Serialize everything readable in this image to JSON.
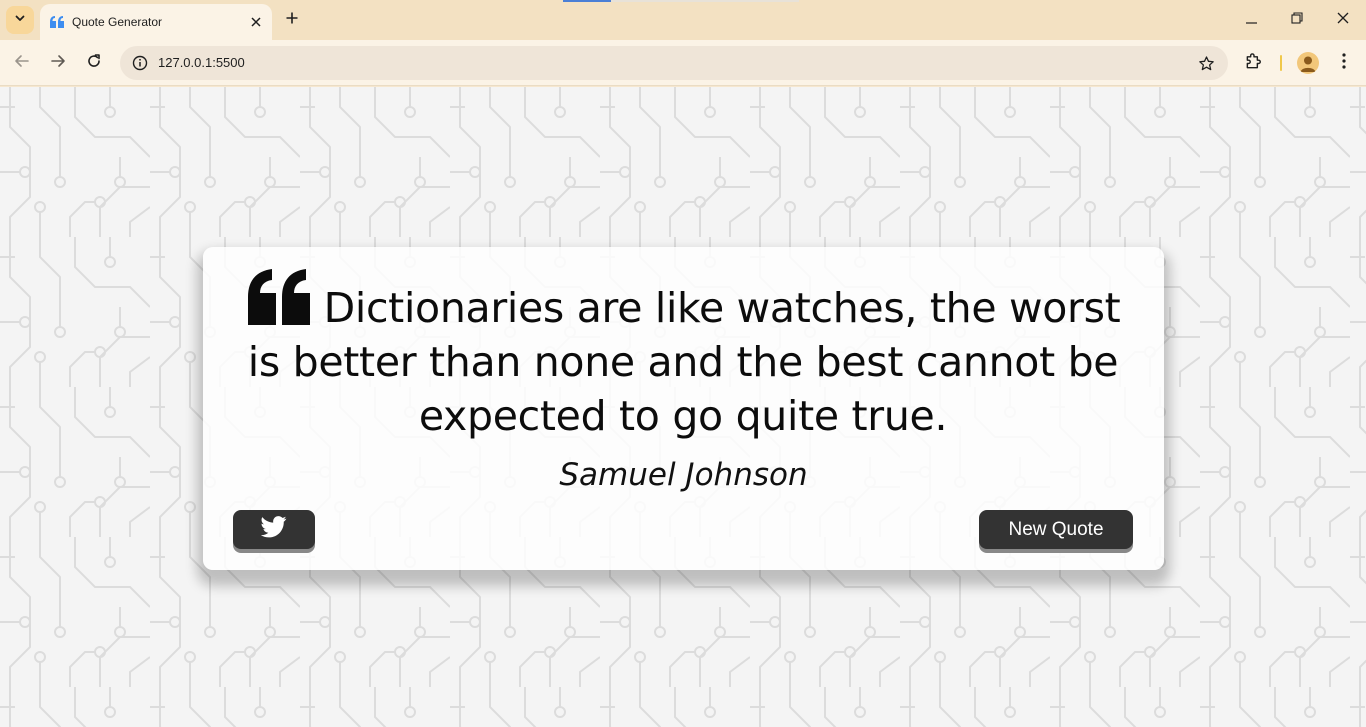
{
  "browser": {
    "tab": {
      "title": "Quote Generator",
      "favicon": "quote-icon"
    },
    "url": "127.0.0.1:5500",
    "accent": "#4a7fd6"
  },
  "page": {
    "quote": "Dictionaries are like watches, the worst is better than none and the best cannot be expected to go quite true.",
    "author": "Samuel Johnson",
    "twitter_button_icon": "twitter-icon",
    "new_quote_label": "New Quote",
    "button_color": "#333333"
  }
}
